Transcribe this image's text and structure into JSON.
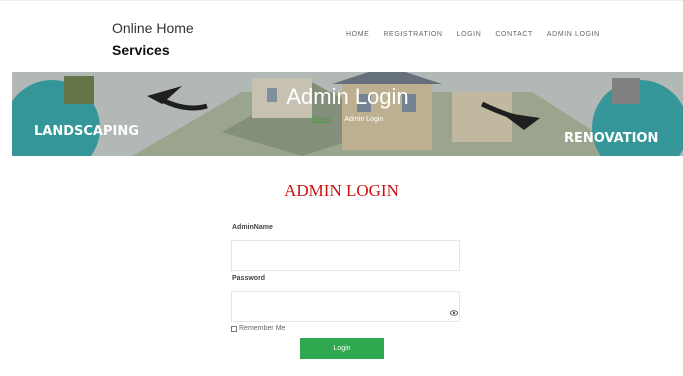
{
  "header": {
    "brand_line1": "Online Home",
    "brand_line2": "Services",
    "nav": [
      "HOME",
      "REGISTRATION",
      "LOGIN",
      "CONTACT",
      "ADMIN LOGIN"
    ]
  },
  "banner": {
    "title": "Admin Login",
    "breadcrumb_home": "Home",
    "breadcrumb_current": "Admin Login",
    "left_badge_text": "LANDSCAPING",
    "right_badge_text": "RENOVATION"
  },
  "form": {
    "heading": "ADMIN LOGIN",
    "username_label": "AdminName",
    "password_label": "Password",
    "remember_label": "Remember Me",
    "submit_label": "Login"
  },
  "colors": {
    "heading_red": "#cc1111",
    "button_green": "#2fa84f",
    "breadcrumb_green": "#3aa53a"
  },
  "icons": {
    "password_toggle": "eye-icon"
  }
}
